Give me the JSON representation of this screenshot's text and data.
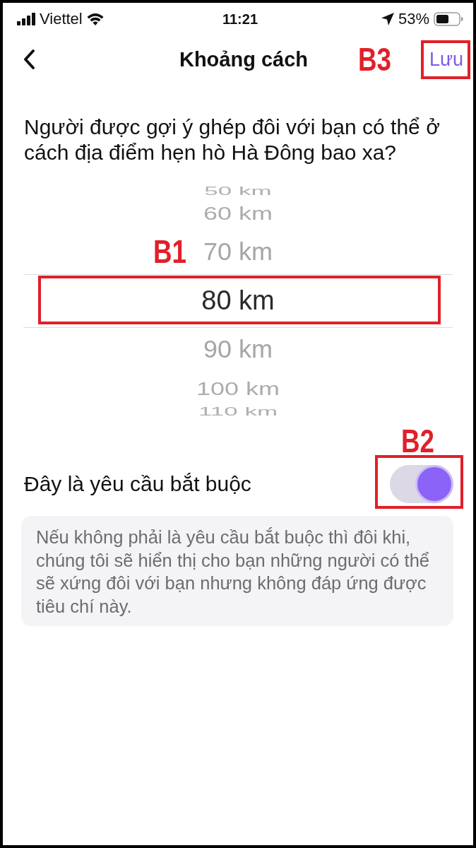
{
  "status_bar": {
    "carrier": "Viettel",
    "time": "11:21",
    "battery": "53%"
  },
  "nav_bar": {
    "title": "Khoảng cách",
    "action": "Lưu"
  },
  "question": "Người được gợi ý ghép đôi với bạn có thể ở cách địa điểm hẹn hò Hà Đông bao xa?",
  "distance_picker": {
    "options": [
      {
        "label": "50 km",
        "selected": false
      },
      {
        "label": "60 km",
        "selected": false
      },
      {
        "label": "70 km",
        "selected": false
      },
      {
        "label": "80 km",
        "selected": true
      },
      {
        "label": "90 km",
        "selected": false
      },
      {
        "label": "100 km",
        "selected": false
      },
      {
        "label": "110 km",
        "selected": false
      }
    ]
  },
  "required_toggle": {
    "label": "Đây là yêu cầu bắt buộc",
    "on": true
  },
  "note": "Nếu không phải là yêu cầu bắt buộc thì đôi khi, chúng tôi sẽ hiển thị cho bạn những người có thể sẽ xứng đôi với bạn nhưng không đáp ứng được tiêu chí này.",
  "annotations": [
    {
      "label": "B1",
      "kind": "picker"
    },
    {
      "label": "B2",
      "kind": "toggle"
    },
    {
      "label": "B3",
      "kind": "save"
    }
  ]
}
